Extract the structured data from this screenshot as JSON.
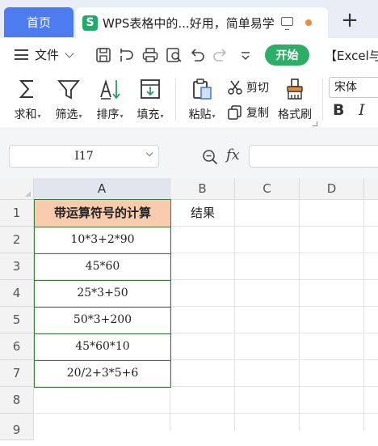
{
  "tabs": {
    "home_label": "首页",
    "doc_title": "WPS表格中的...好用，简单易学",
    "doc_logo": "S",
    "add_label": "+"
  },
  "menu": {
    "file_label": "文件",
    "start_label": "开始",
    "excel_label": "【Excel与"
  },
  "ribbon": {
    "sum_label": "求和",
    "filter_label": "筛选",
    "sort_label": "排序",
    "fill_label": "填充",
    "paste_label": "粘贴",
    "cut_label": "剪切",
    "copy_label": "复制",
    "format_painter_label": "格式刷",
    "font_name": "宋体",
    "bold_label": "B",
    "italic_label": "I"
  },
  "formula_bar": {
    "cell_ref": "I17",
    "fx_label": "fx",
    "formula": ""
  },
  "grid": {
    "columns": [
      "A",
      "B",
      "C",
      "D"
    ],
    "rows": [
      "1",
      "2",
      "3",
      "4",
      "5",
      "6",
      "7",
      "8",
      "9"
    ],
    "a1": "带运算符号的计算",
    "b1": "结果",
    "values": [
      "10*3+2*90",
      "45*60",
      "25*3+50",
      "50*3+200",
      "45*60*10",
      "20/2+3*5+6"
    ]
  },
  "colors": {
    "accent_blue": "#4d7cf0",
    "start_green": "#2cae66",
    "header_fill": "#f8cbad",
    "table_border": "#3a7a3a"
  }
}
